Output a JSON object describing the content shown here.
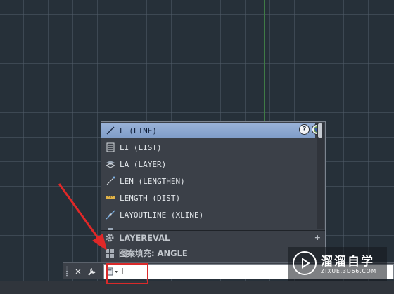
{
  "suggestions": [
    {
      "label": "L (LINE)",
      "icon": "line-icon"
    },
    {
      "label": "LI (LIST)",
      "icon": "list-icon"
    },
    {
      "label": "LA (LAYER)",
      "icon": "layer-icon"
    },
    {
      "label": "LEN (LENGTHEN)",
      "icon": "lengthen-icon"
    },
    {
      "label": "LENGTH (DIST)",
      "icon": "ruler-icon"
    },
    {
      "label": "LAYOUTLINE (XLINE)",
      "icon": "xline-icon"
    }
  ],
  "sysvar_row": {
    "label": "LAYEREVAL",
    "expand": "+"
  },
  "hatch_row": {
    "label": "图案填充: ANGLE"
  },
  "help_button": "?",
  "command_line": {
    "input_value": "L"
  },
  "watermark": {
    "brand": "溜溜自学",
    "url": "ZIXUE.3D66.COM"
  },
  "colors": {
    "selection": "#8aa6d0",
    "highlight_box": "#d92a2a",
    "y_axis": "#3f7a46"
  }
}
